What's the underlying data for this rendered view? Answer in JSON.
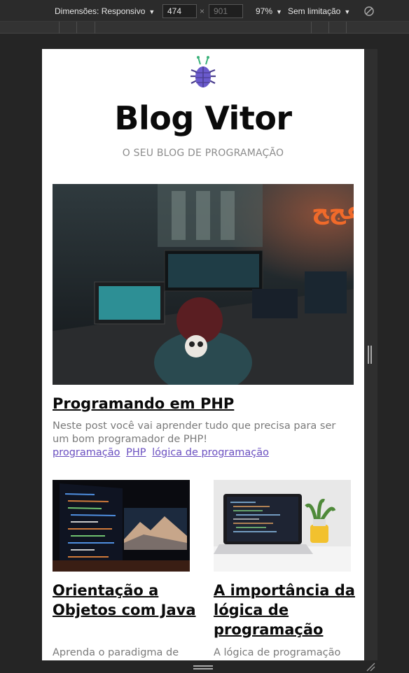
{
  "devtools": {
    "dimensions_label": "Dimensões: Responsivo",
    "width_value": "474",
    "height_placeholder": "901",
    "times": "×",
    "zoom": "97%",
    "throttle": "Sem limitação"
  },
  "site": {
    "logo_icon": "bug-icon",
    "title": "Blog Vitor",
    "subtitle": "O SEU BLOG DE PROGRAMAÇÃO"
  },
  "featured_post": {
    "title": "Programando em PHP",
    "excerpt": "Neste post você vai aprender tudo que precisa para ser um bom programador de PHP!",
    "tags": [
      "programação",
      "PHP",
      "lógica de programação"
    ],
    "image_icon": "hacker-workspace-photo"
  },
  "posts": [
    {
      "title": "Orientação a Objetos com Java",
      "excerpt": "Aprenda o paradigma de",
      "image_icon": "code-monitors-photo"
    },
    {
      "title": "A importância da lógica de programação",
      "excerpt": "A lógica de programação",
      "image_icon": "laptop-desk-photo"
    }
  ],
  "colors": {
    "accent": "#6a4fc0",
    "title": "#0a0a0a",
    "muted": "#7a7a7a",
    "devtools_bg": "#262626"
  }
}
